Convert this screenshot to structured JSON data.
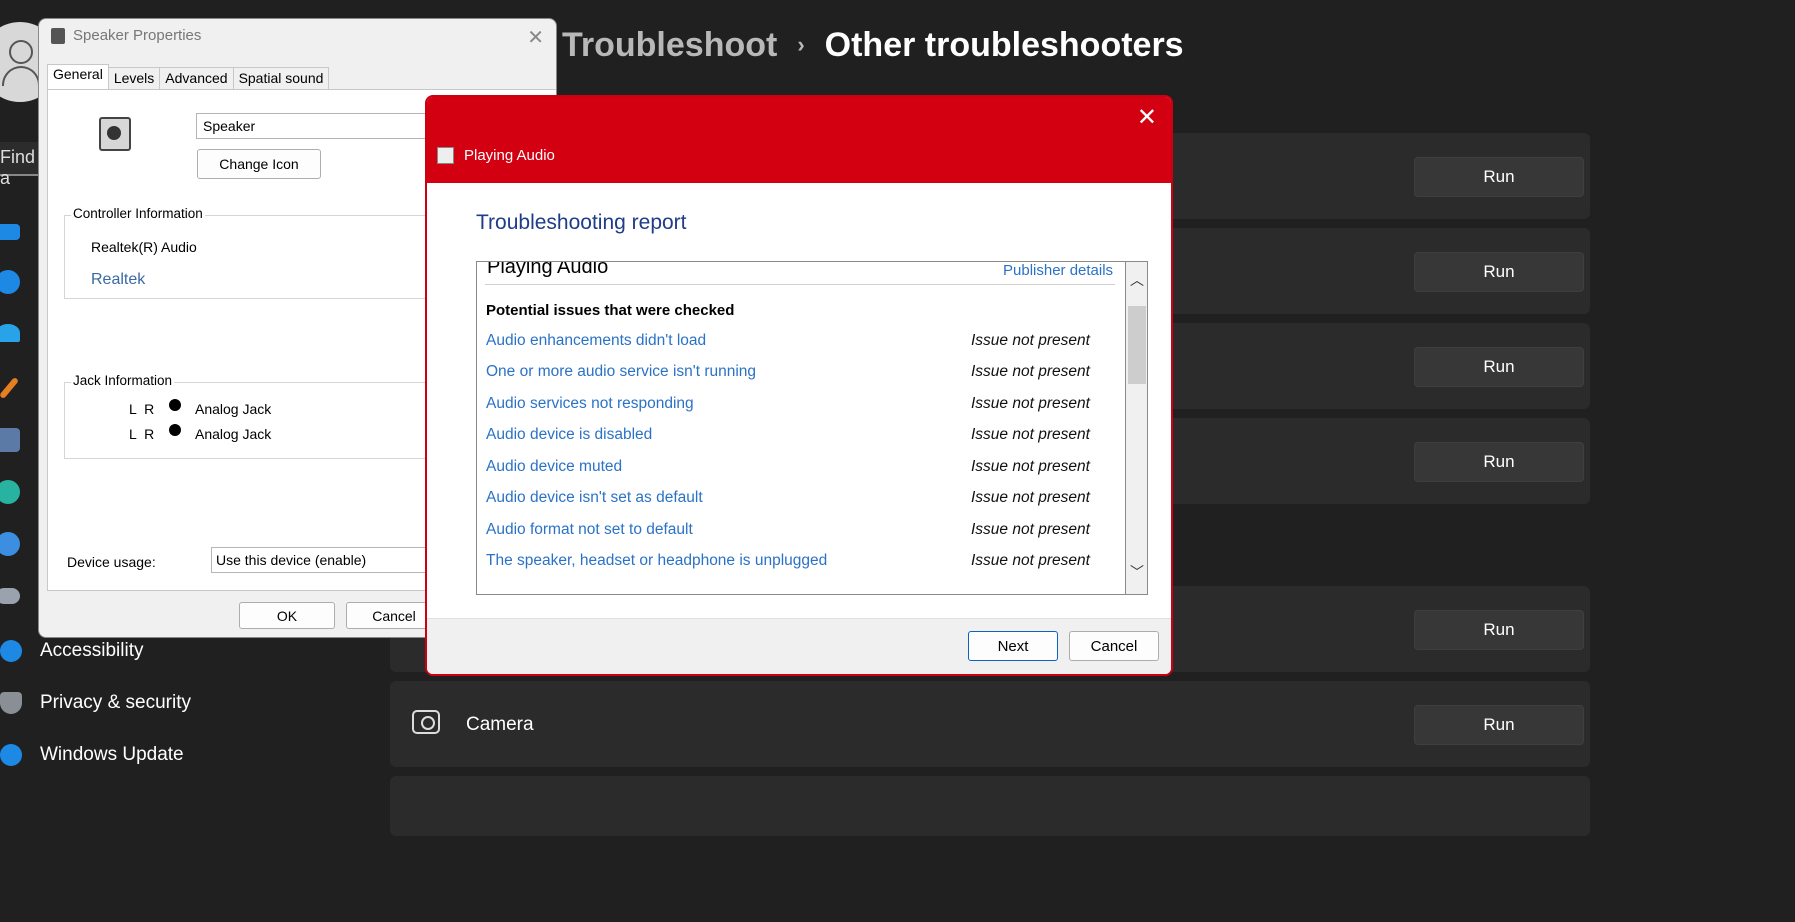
{
  "settings": {
    "breadcrumb_parent": "Troubleshoot",
    "breadcrumb_sep": "›",
    "breadcrumb_current": "Other troubleshooters",
    "find_text": "Find a",
    "run_label": "Run",
    "camera_label": "Camera",
    "nav": {
      "accessibility": "Accessibility",
      "privacy": "Privacy & security",
      "update": "Windows Update"
    }
  },
  "speaker_dialog": {
    "title": "Speaker Properties",
    "tabs": [
      "General",
      "Levels",
      "Advanced",
      "Spatial sound"
    ],
    "device_name": "Speaker",
    "change_icon_label": "Change Icon",
    "controller_group": "Controller Information",
    "controller_name": "Realtek(R) Audio",
    "controller_link": "Realtek",
    "jack_group": "Jack Information",
    "jacks": [
      {
        "channels": "L R",
        "type": "Analog Jack"
      },
      {
        "channels": "L R",
        "type": "Analog Jack"
      }
    ],
    "device_usage_label": "Device usage:",
    "device_usage_value": "Use this device (enable)",
    "ok_label": "OK",
    "cancel_label": "Cancel"
  },
  "troubleshooter": {
    "title": "Playing Audio",
    "heading": "Troubleshooting report",
    "report_name": "Playing Audio",
    "publisher_link": "Publisher details",
    "checked_heading": "Potential issues that were checked",
    "issues": [
      {
        "name": "Audio enhancements didn't load",
        "status": "Issue not present"
      },
      {
        "name": "One or more audio service isn't running",
        "status": "Issue not present"
      },
      {
        "name": "Audio services not responding",
        "status": "Issue not present"
      },
      {
        "name": "Audio device is disabled",
        "status": "Issue not present"
      },
      {
        "name": "Audio device muted",
        "status": "Issue not present"
      },
      {
        "name": "Audio device isn't set as default",
        "status": "Issue not present"
      },
      {
        "name": "Audio format not set to default",
        "status": "Issue not present"
      },
      {
        "name": "The speaker, headset or headphone is unplugged",
        "status": "Issue not present"
      }
    ],
    "next_label": "Next",
    "cancel_label": "Cancel"
  },
  "colors": {
    "accent_red": "#d20011",
    "link_blue": "#2a72c7",
    "settings_bg": "#202020"
  }
}
